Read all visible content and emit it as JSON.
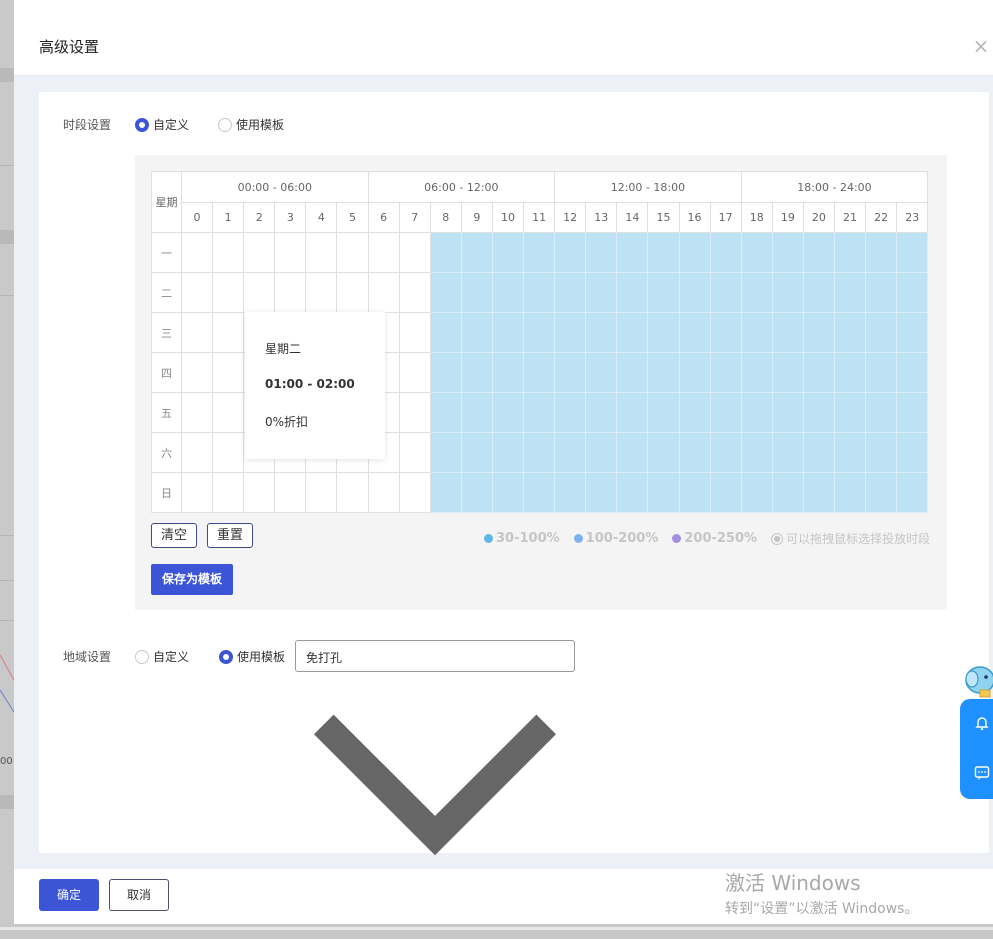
{
  "dialog": {
    "title": "高级设置",
    "close_icon": "close-icon"
  },
  "time_setting": {
    "label": "时段设置",
    "options": [
      {
        "label": "自定义",
        "selected": true
      },
      {
        "label": "使用模板",
        "selected": false
      }
    ]
  },
  "schedule": {
    "week_header": "星期",
    "groups": [
      "00:00 - 06:00",
      "06:00 - 12:00",
      "12:00 - 18:00",
      "18:00 - 24:00"
    ],
    "hours": [
      "0",
      "1",
      "2",
      "3",
      "4",
      "5",
      "6",
      "7",
      "8",
      "9",
      "10",
      "11",
      "12",
      "13",
      "14",
      "15",
      "16",
      "17",
      "18",
      "19",
      "20",
      "21",
      "22",
      "23"
    ],
    "days": [
      "一",
      "二",
      "三",
      "四",
      "五",
      "六",
      "日"
    ],
    "selected_hours_start": 8,
    "selected_hours_end": 23,
    "selected_color": "#bde2f3",
    "tooltip": {
      "day": "星期二",
      "time": "01:00 - 02:00",
      "discount": "0%折扣"
    },
    "clear_label": "清空",
    "reset_label": "重置",
    "save_template_label": "保存为模板",
    "legend": [
      {
        "label": "30-100%",
        "color": "#5fb8e8"
      },
      {
        "label": "100-200%",
        "color": "#7ab2f2"
      },
      {
        "label": "200-250%",
        "color": "#a58de0"
      }
    ],
    "hint": "可以拖拽鼠标选择投放时段"
  },
  "region_setting": {
    "label": "地域设置",
    "options": [
      {
        "label": "自定义",
        "selected": false
      },
      {
        "label": "使用模板",
        "selected": true
      }
    ],
    "select_value": "免打孔"
  },
  "footer": {
    "ok_label": "确定",
    "cancel_label": "取消"
  },
  "watermark": {
    "line1": "激活 Windows",
    "line2": "转到“设置”以激活 Windows。"
  },
  "background": {
    "fragment_text": "00"
  },
  "colors": {
    "primary": "#3b55d6",
    "float_widget": "#1e90ff"
  }
}
